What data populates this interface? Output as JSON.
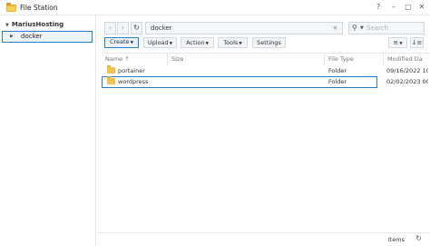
{
  "window": {
    "title": "File Station",
    "help_icon": "?",
    "minimize_icon": "–",
    "maximize_icon": "▢",
    "close_icon": "✕"
  },
  "sidebar": {
    "root_label": "MariusHosting",
    "items": [
      {
        "label": "docker",
        "selected": true
      }
    ]
  },
  "nav": {
    "back": "‹",
    "forward": "›",
    "refresh": "↻",
    "path": "docker",
    "favorite_icon": "★",
    "search_placeholder": "Search"
  },
  "toolbar": {
    "buttons": [
      {
        "label": "Create"
      },
      {
        "label": "Upload"
      },
      {
        "label": "Action"
      },
      {
        "label": "Tools"
      },
      {
        "label": "Settings"
      }
    ],
    "list_view_icon": "≡",
    "sort_icon": "↓≡"
  },
  "table": {
    "columns": [
      "Name ↑",
      "Size",
      "File Type",
      "Modified Da"
    ],
    "rows": [
      {
        "name": "portainer",
        "size": "",
        "type": "Folder",
        "modified": "09/16/2022 10",
        "selected": false
      },
      {
        "name": "wordpress",
        "size": "",
        "type": "Folder",
        "modified": "02/02/2023 00",
        "selected": true
      }
    ]
  },
  "status": {
    "items_label": "Items",
    "refresh_icon": "↻"
  },
  "colors": {
    "accent": "#2a7ec8",
    "folder": "#f2c14a"
  }
}
